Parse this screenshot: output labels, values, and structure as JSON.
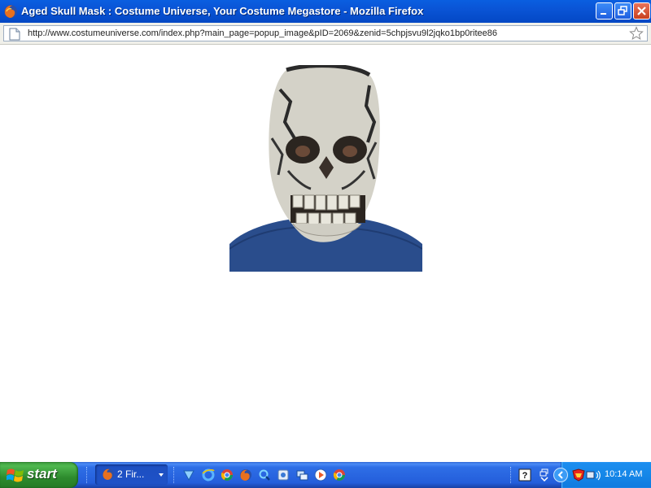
{
  "window": {
    "title": "Aged Skull Mask : Costume Universe, Your Costume Megastore - Mozilla Firefox"
  },
  "addressbar": {
    "url": "http://www.costumeuniverse.com/index.php?main_page=popup_image&pID=2069&zenid=5chpjsvu9l2jqko1bp0ritee86"
  },
  "content": {
    "image_subject": "aged-skull-mask"
  },
  "taskbar": {
    "start_label": "start",
    "task_label": "2 Fir...",
    "clock": "10:14 AM"
  },
  "colors": {
    "titlebar": "#0a54d6",
    "taskbar": "#245edb",
    "start": "#3c9b3c",
    "tray": "#1587e8",
    "shirt": "#2a4d8c",
    "mask": "#d4d2c8"
  }
}
